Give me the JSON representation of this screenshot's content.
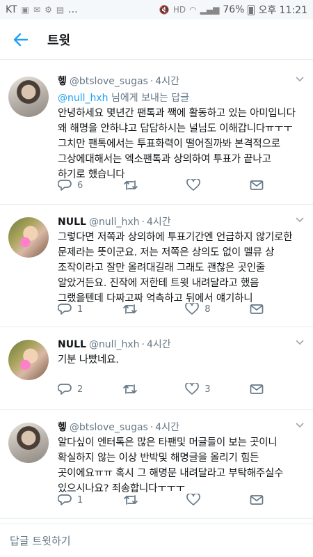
{
  "status_bar": {
    "carrier": "KT",
    "more": "...",
    "battery": "76%",
    "time": "오후 11:21"
  },
  "header": {
    "title": "트윗"
  },
  "tweets": [
    {
      "name": "헿",
      "handle": "@btslove_sugas",
      "time": "4시간",
      "reply_to_handle": "@null_hxh",
      "reply_to_suffix": "님에게 보내는 답글",
      "text": "안녕하세요 몇년간 팬톡과 짹에 활동하고 있는 아미입니다\n왜 해명을 안하냐고 답답하시는 널님도 이해갑니다ㅠㅜㅜ\n그치만 팬톡에서는 투표화력이 떨어질까봐  본격적으로\n그상에대해서는 엑소팬톡과 상의하여 투표가 끝나고\n하기로 했습니다",
      "replies": "6",
      "retweets": "",
      "likes": ""
    },
    {
      "name": "NULL",
      "handle": "@null_hxh",
      "time": "4시간",
      "text": "그렇다면 저쪽과 상의하에 투표기간엔 언급하지 않기로한\n문제라는 뜻이군요. 저는 저쪽은 상의도 없이 멜뮤 상\n조작이라고 잘만 올려대길래 그래도 괜찮은 곳인줄\n알았거든요. 진작에 저한테 트윗 내려달라고 했음\n그랬을텐데 다짜고짜 억측하고 뒤에서 얘기하니",
      "replies": "1",
      "retweets": "",
      "likes": "8"
    },
    {
      "name": "NULL",
      "handle": "@null_hxh",
      "time": "4시간",
      "text": "기분 나빴네요.",
      "replies": "2",
      "retweets": "",
      "likes": "3"
    },
    {
      "name": "헿",
      "handle": "@btslove_sugas",
      "time": "4시간",
      "text": "알다싶이 엔터톡은 많은 타팬및 머글들이 보는 곳이니\n확실하지 않는 이상 반박및 해명글을 올리기 힘든\n곳이에요ㅠㅠ 혹시 그 해명문 내려달라고 부탁해주실수\n있으시나요? 죄송합니다ㅜㅜㅜ",
      "replies": "1",
      "retweets": "",
      "likes": ""
    }
  ],
  "reply_bar": {
    "label": "답글 트윗하기"
  },
  "colors": {
    "accent": "#1da1f2",
    "secondary_text": "#657786",
    "divider": "#e6ecf0"
  },
  "icons": [
    "back-arrow-icon",
    "reply-icon",
    "retweet-icon",
    "like-icon",
    "message-icon",
    "caret-down-icon"
  ]
}
